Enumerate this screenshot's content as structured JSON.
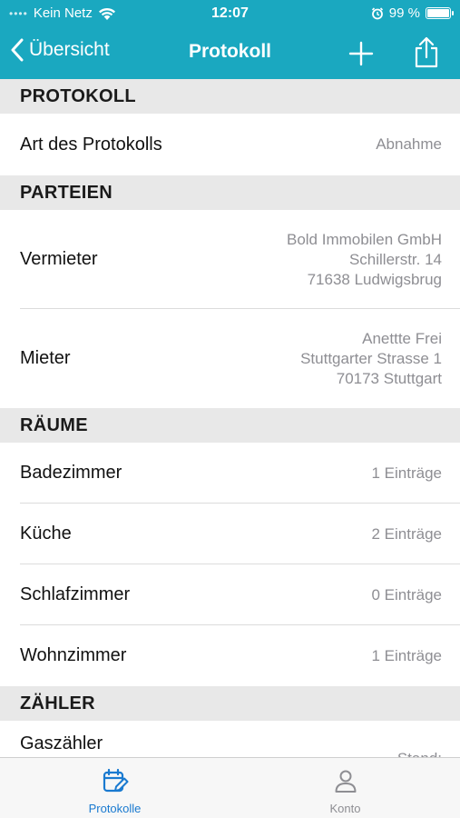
{
  "status_bar": {
    "carrier": "Kein Netz",
    "time": "12:07",
    "battery": "99 %",
    "battery_level": 0.99
  },
  "nav": {
    "back_label": "Übersicht",
    "title": "Protokoll"
  },
  "sections": {
    "protokoll": {
      "title": "PROTOKOLL",
      "rows": [
        {
          "label": "Art des Protokolls",
          "value": "Abnahme"
        }
      ]
    },
    "parteien": {
      "title": "PARTEIEN",
      "vermieter": {
        "label": "Vermieter",
        "lines": [
          "Bold Immobilen GmbH",
          "Schillerstr. 14",
          "71638 Ludwigsbrug"
        ]
      },
      "mieter": {
        "label": "Mieter",
        "lines": [
          "Anettte Frei",
          "Stuttgarter Strasse 1",
          "70173 Stuttgart"
        ]
      }
    },
    "raeume": {
      "title": "RÄUME",
      "rows": [
        {
          "label": "Badezimmer",
          "value": "1 Einträge"
        },
        {
          "label": "Küche",
          "value": "2 Einträge"
        },
        {
          "label": "Schlafzimmer",
          "value": "0 Einträge"
        },
        {
          "label": "Wohnzimmer",
          "value": "1 Einträge"
        }
      ]
    },
    "zaehler": {
      "title": "ZÄHLER",
      "rows": [
        {
          "label": "Gaszähler",
          "value": "Stand:"
        }
      ]
    }
  },
  "tabs": [
    {
      "label": "Protokolle",
      "active": true
    },
    {
      "label": "Konto",
      "active": false
    }
  ],
  "colors": {
    "accent": "#1aa8c0",
    "tab_active": "#1a7ad0",
    "tab_inactive": "#8e8e93"
  }
}
